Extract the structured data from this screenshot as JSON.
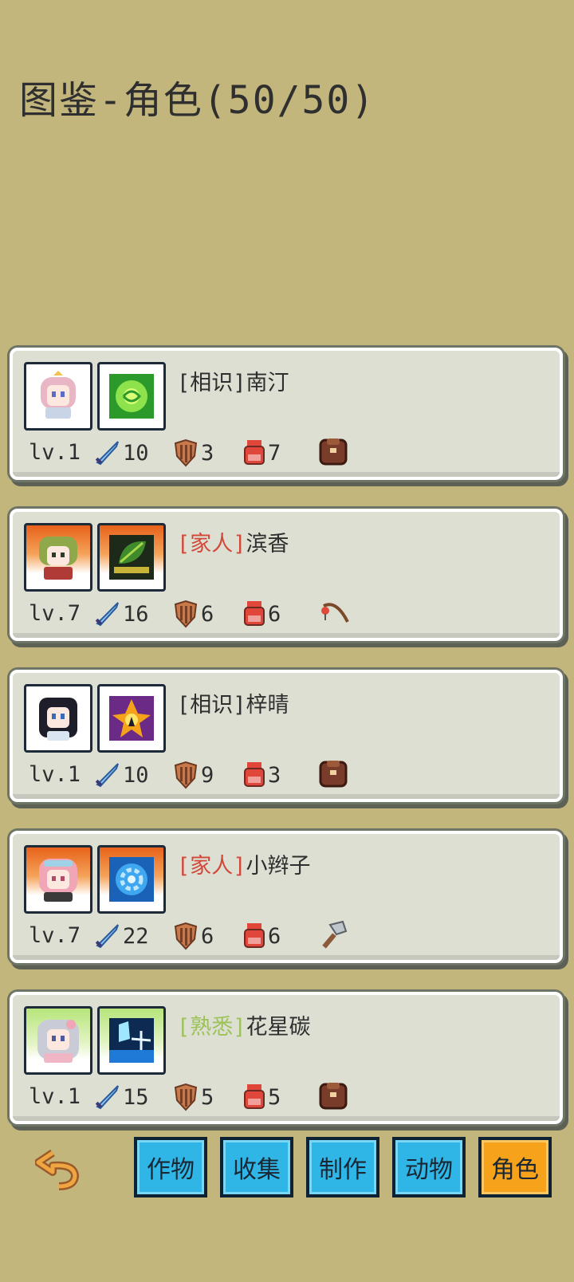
{
  "title": "图鉴-角色(50/50)",
  "relation_colors": {
    "相识": "#2e2e2e",
    "家人": "#d2493a",
    "熟悉": "#9cc25a"
  },
  "characters": [
    {
      "relation": "相识",
      "name": "南汀",
      "level": "lv.1",
      "attack": "10",
      "defense": "3",
      "stamina": "7",
      "tool_icon": "backpack-icon",
      "frame": "plain",
      "skill_icon": "green-swirl-skill-icon"
    },
    {
      "relation": "家人",
      "name": "滨香",
      "level": "lv.7",
      "attack": "16",
      "defense": "6",
      "stamina": "6",
      "tool_icon": "fishing-rod-icon",
      "frame": "orange",
      "skill_icon": "leaf-skill-icon"
    },
    {
      "relation": "相识",
      "name": "梓晴",
      "level": "lv.1",
      "attack": "10",
      "defense": "9",
      "stamina": "3",
      "tool_icon": "backpack-icon",
      "frame": "plain",
      "skill_icon": "fire-burst-skill-icon"
    },
    {
      "relation": "家人",
      "name": "小辫子",
      "level": "lv.7",
      "attack": "22",
      "defense": "6",
      "stamina": "6",
      "tool_icon": "axe-icon",
      "frame": "orange",
      "skill_icon": "blue-gear-skill-icon"
    },
    {
      "relation": "熟悉",
      "name": "花星碳",
      "level": "lv.1",
      "attack": "15",
      "defense": "5",
      "stamina": "5",
      "tool_icon": "backpack-icon",
      "frame": "green",
      "skill_icon": "crystal-skill-icon"
    }
  ],
  "tabs": [
    {
      "label": "作物",
      "active": false
    },
    {
      "label": "收集",
      "active": false
    },
    {
      "label": "制作",
      "active": false
    },
    {
      "label": "动物",
      "active": false
    },
    {
      "label": "角色",
      "active": true
    }
  ],
  "back_icon": "return-arrow-icon"
}
